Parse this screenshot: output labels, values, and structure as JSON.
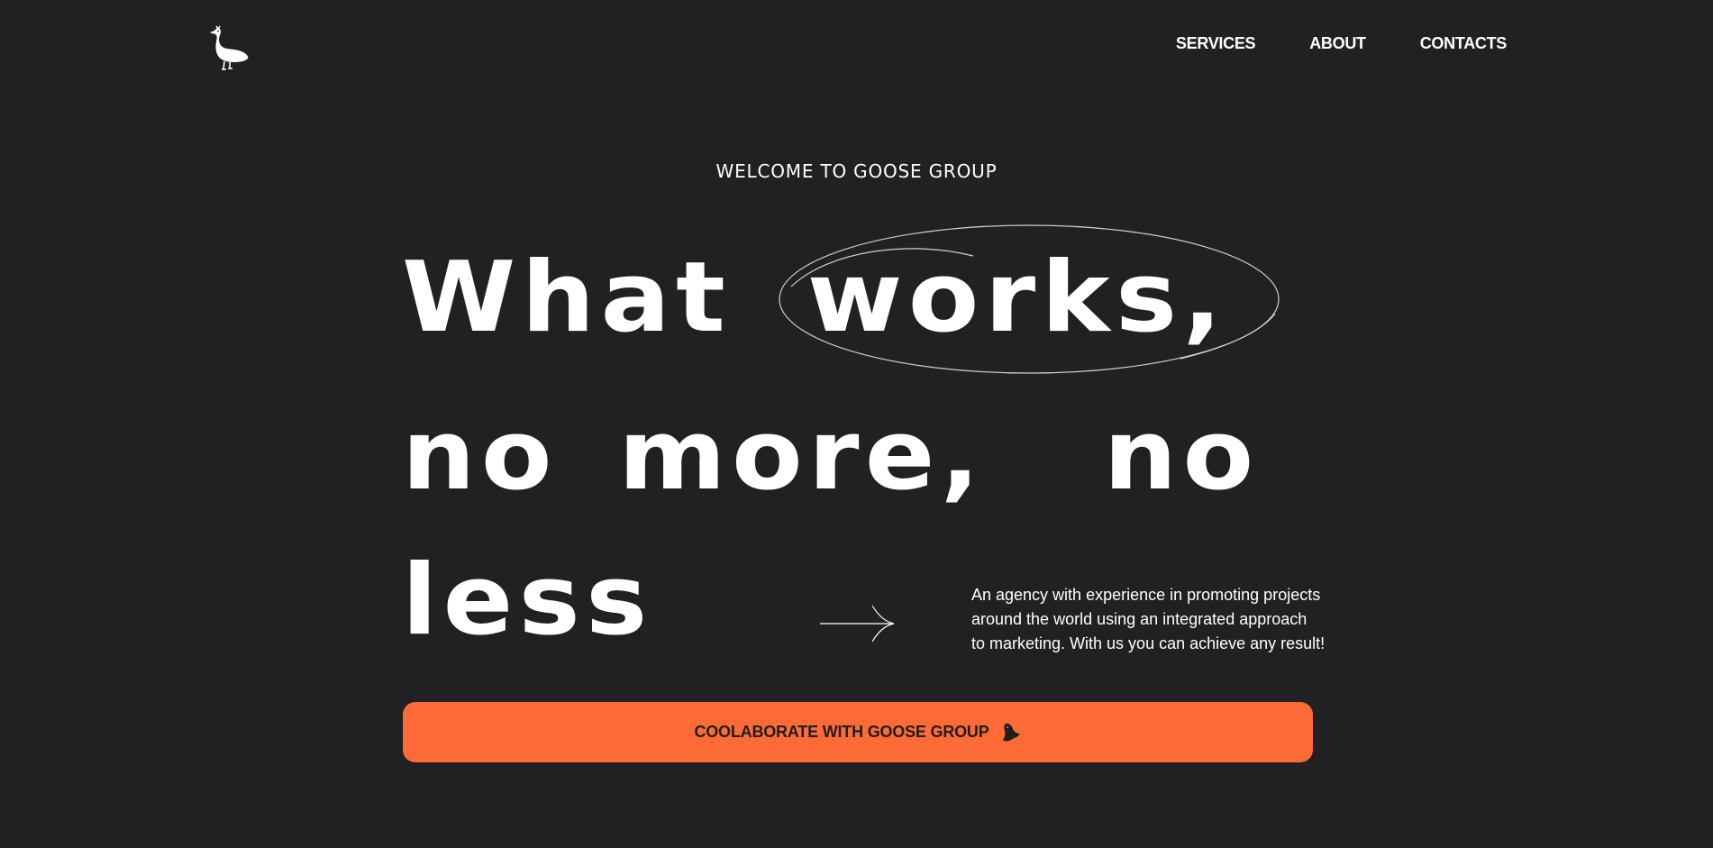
{
  "header": {
    "logo_icon": "goose-logo-icon",
    "nav": [
      {
        "label": "SERVICES"
      },
      {
        "label": "ABOUT"
      },
      {
        "label": "CONTACTS"
      }
    ]
  },
  "hero": {
    "eyebrow": "WELCOME TO GOOSE GROUP",
    "headline": {
      "line1_a": "What",
      "line1_b": "works,",
      "line2_a": "no",
      "line2_b": "more,",
      "line2_c": "no",
      "line3": "less"
    },
    "arrow_icon": "arrow-right-icon",
    "description_lines": [
      "An agency with experience in promoting projects",
      "around the world using an integrated approach",
      "to marketing. With us you can achieve any result!"
    ]
  },
  "cta": {
    "label": "COOLABORATE WITH GOOSE GROUP",
    "icon": "goose-head-icon"
  },
  "colors": {
    "background": "#212124",
    "accent": "#ff6b37",
    "text": "#ffffff",
    "cta_text": "#1e1e20"
  }
}
